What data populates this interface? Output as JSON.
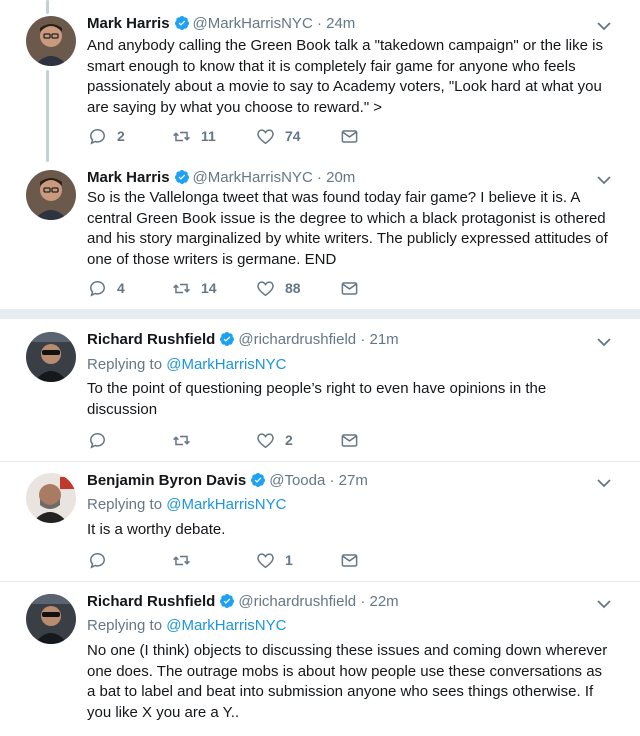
{
  "tweets": [
    {
      "name": "Mark Harris",
      "verified": true,
      "handle": "@MarkHarrisNYC",
      "time": "· 24m",
      "replying_label": "",
      "replying_to": "",
      "text": "And anybody calling the Green Book talk a \"takedown campaign\" or the like is smart enough to know that it is completely fair game for anyone who feels passionately about a movie to say to Academy voters, \"Look hard at what you are saying by what you choose to reward.\" >",
      "replies": "2",
      "retweets": "11",
      "likes": "74"
    },
    {
      "name": "Mark Harris",
      "verified": true,
      "handle": "@MarkHarrisNYC",
      "time": "· 20m",
      "replying_label": "",
      "replying_to": "",
      "text": "So is the Vallelonga tweet that was found today fair game? I believe it is. A central Green Book issue is the degree to which a black protagonist is othered and his story marginalized by white writers. The publicly expressed attitudes of one of those writers is germane. END",
      "replies": "4",
      "retweets": "14",
      "likes": "88"
    },
    {
      "name": "Richard Rushfield",
      "verified": true,
      "handle": "@richardrushfield",
      "time": "· 21m",
      "replying_label": "Replying to",
      "replying_to": "@MarkHarrisNYC",
      "text": "To the point of questioning people’s right to even have opinions in the discussion",
      "replies": "",
      "retweets": "",
      "likes": "2"
    },
    {
      "name": "Benjamin Byron Davis",
      "verified": true,
      "handle": "@Tooda",
      "time": "· 27m",
      "replying_label": "Replying to",
      "replying_to": "@MarkHarrisNYC",
      "text": "It is a worthy debate.",
      "replies": "",
      "retweets": "",
      "likes": "1"
    },
    {
      "name": "Richard Rushfield",
      "verified": true,
      "handle": "@richardrushfield",
      "time": "· 22m",
      "replying_label": "Replying to",
      "replying_to": "@MarkHarrisNYC",
      "text": "No one (I think) objects to discussing these issues and coming down wherever one does. The outrage mobs is about how people use these conversations as a bat to label and beat into submission anyone who sees things otherwise. If you like X you are a Y..",
      "replies": "",
      "retweets": "",
      "likes": ""
    }
  ],
  "icons": {
    "reply": "reply-icon",
    "retweet": "retweet-icon",
    "like": "heart-icon",
    "dm": "envelope-icon",
    "menu": "chevron-down-icon",
    "verified": "verified-badge-icon"
  },
  "colors": {
    "link": "#1b95e0",
    "verified": "#1da1f2",
    "muted": "#657786",
    "divider": "#e6ecf0"
  }
}
